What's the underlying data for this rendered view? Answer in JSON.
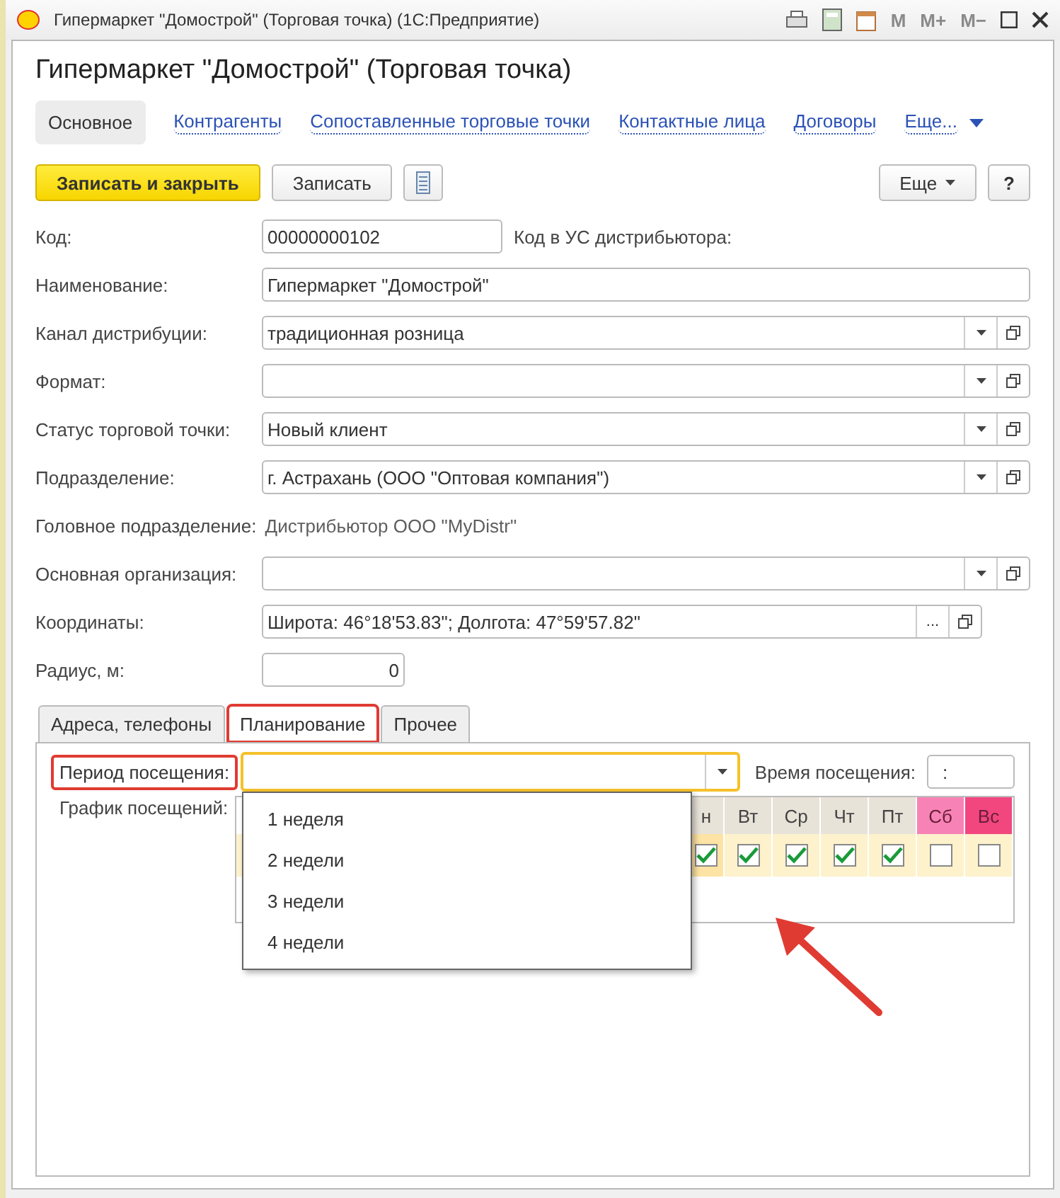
{
  "window": {
    "title": "Гипермаркет \"Домострой\" (Торговая точка)  (1С:Предприятие)",
    "memory_buttons": [
      "M",
      "M+",
      "M−"
    ]
  },
  "heading": "Гипермаркет \"Домострой\" (Торговая точка)",
  "nav": [
    {
      "label": "Основное",
      "selected": true
    },
    {
      "label": "Контрагенты",
      "selected": false
    },
    {
      "label": "Сопоставленные торговые точки",
      "selected": false
    },
    {
      "label": "Контактные лица",
      "selected": false
    },
    {
      "label": "Договоры",
      "selected": false
    },
    {
      "label": "Еще...",
      "selected": false,
      "kind": "more"
    }
  ],
  "commands": {
    "left": [
      {
        "label": "Записать и закрыть",
        "kind": "primary"
      },
      {
        "label": "Записать",
        "kind": "plain"
      }
    ],
    "more": "Еще",
    "help": "?"
  },
  "fields": [
    {
      "kind": "text",
      "label": "Код:",
      "value": "00000000102",
      "side_label": "Код в УС дистрибьютора:"
    },
    {
      "kind": "text",
      "label": "Наименование:",
      "value": "Гипермаркет \"Домострой\""
    },
    {
      "kind": "select",
      "label": "Канал дистрибуции:",
      "value": "традиционная розница"
    },
    {
      "kind": "select",
      "label": "Формат:"
    },
    {
      "kind": "select",
      "label": "Статус торговой точки:",
      "value": "Новый клиент"
    },
    {
      "kind": "select",
      "label": "Подразделение:",
      "value": "г. Астрахань (ООО \"Оптовая компания\")"
    },
    {
      "kind": "static",
      "label": "Головное подразделение:",
      "value": "Дистрибьютор ООО \"MyDistr\""
    },
    {
      "kind": "select",
      "label": "Основная организация:"
    },
    {
      "kind": "picker",
      "label": "Координаты:",
      "value": "Широта: 46°18'53.83\"; Долгота: 47°59'57.82\"",
      "button": "..."
    },
    {
      "kind": "number",
      "label": "Радиус, м:",
      "value": "0"
    }
  ],
  "tabs": [
    {
      "label": "Адреса, телефоны",
      "selected": false,
      "highlighted": false
    },
    {
      "label": "Планирование",
      "selected": true,
      "highlighted": true
    },
    {
      "label": "Прочее",
      "selected": false,
      "highlighted": false
    }
  ],
  "planning": {
    "period": {
      "label": "Период посещения:",
      "highlighted": true,
      "open": true
    },
    "time": {
      "label": "Время посещения:",
      "value": ":"
    },
    "schedule_label": "График посещений:",
    "days": [
      {
        "label": "н",
        "color": "#e8e3d8",
        "checked": true
      },
      {
        "label": "Вт",
        "color": "#e8e3d8",
        "checked": true
      },
      {
        "label": "Ср",
        "color": "#e8e3d8",
        "checked": true
      },
      {
        "label": "Чт",
        "color": "#e8e3d8",
        "checked": true
      },
      {
        "label": "Пт",
        "color": "#e8e3d8",
        "checked": true
      },
      {
        "label": "Сб",
        "color": "#f783b6",
        "checked": false
      },
      {
        "label": "Вс",
        "color": "#f2467f",
        "checked": false
      }
    ],
    "options": [
      "1 неделя",
      "2 недели",
      "3 недели",
      "4 недели"
    ]
  }
}
